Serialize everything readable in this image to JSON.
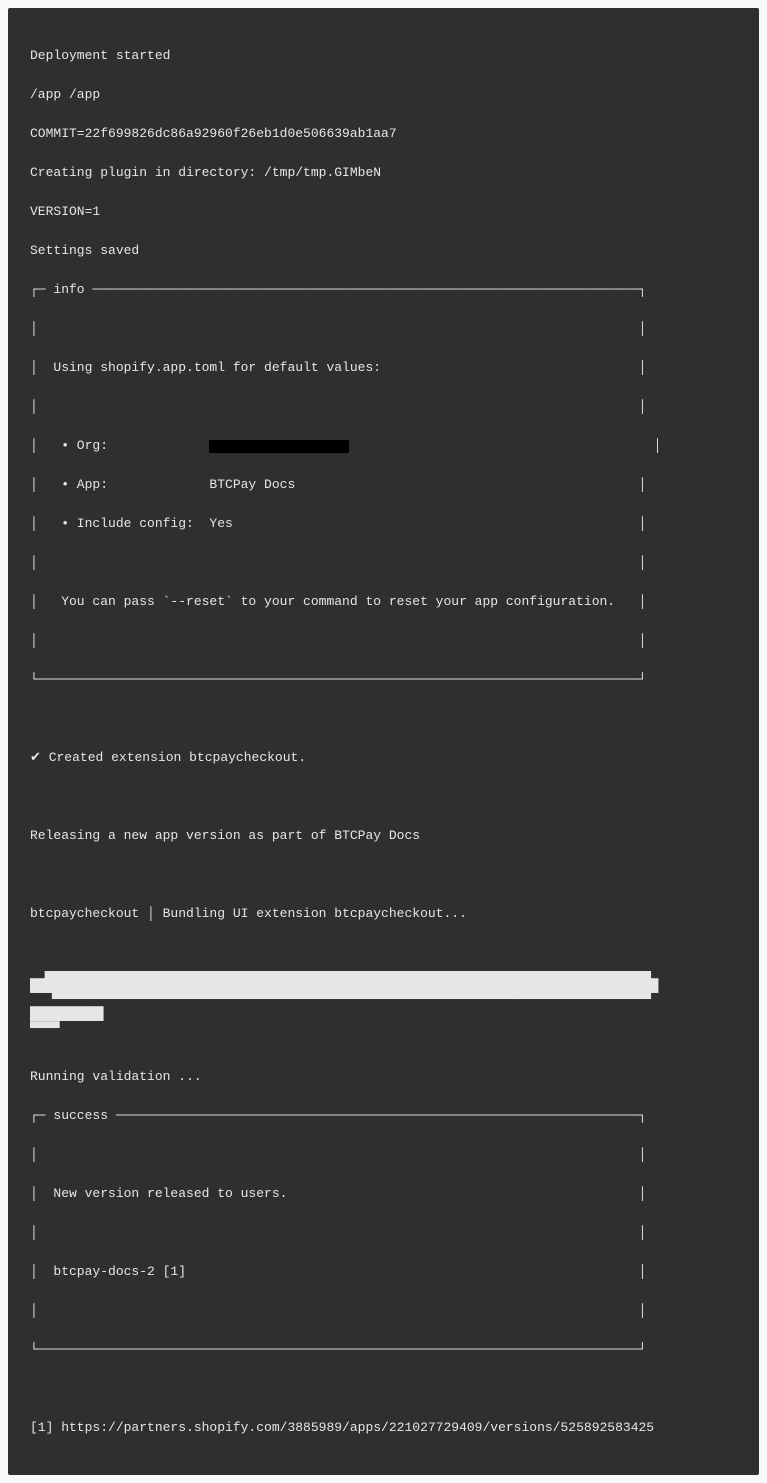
{
  "preamble": {
    "l1": "Deployment started",
    "l2": "/app /app",
    "l3": "COMMIT=22f699826dc86a92960f26eb1d0e506639ab1aa7",
    "l4": "Creating plugin in directory: /tmp/tmp.GIMbeN",
    "l5": "VERSION=1",
    "l6": "Settings saved"
  },
  "info_box": {
    "top": "┌─ info ──────────────────────────────────────────────────────────────────────┐",
    "r1": "│                                                                             │",
    "r2": "│  Using shopify.app.toml for default values:                                 │",
    "r3": "│                                                                             │",
    "r4a": "│   • Org:             ",
    "r4b": "                                       │",
    "r5": "│   • App:             BTCPay Docs                                            │",
    "r6": "│   • Include config:  Yes                                                    │",
    "r7": "│                                                                             │",
    "r8": "│   You can pass `--reset` to your command to reset your app configuration.   │",
    "r9": "│                                                                             │",
    "bot": "└─────────────────────────────────────────────────────────────────────────────┘"
  },
  "mid": {
    "l1": "✔ Created extension btcpaycheckout.",
    "l2": "Releasing a new app version as part of BTCPay Docs",
    "l3": "btcpaycheckout │ Bundling UI extension btcpaycheckout..."
  },
  "wave": {
    "r1": "  ▄▄▄▄▄▄▄▄▄▄▄▄▄▄▄▄▄▄▄▄▄▄▄▄▄▄▄▄▄▄▄▄▄▄▄▄▄▄▄▄▄▄▄▄▄▄▄▄▄▄▄▄▄▄▄▄▄▄▄▄▄▄▄▄▄▄▄▄▄▄▄▄▄▄▄▄▄▄▄▄▄▄▄",
    "r2": "██████████████████████████████████████████████████████████████████████████████████████",
    "r3": "   ▀▀▀▀▀▀▀▀▀▀▀▀▀▀▀▀▀▀▀▀▀▀▀▀▀▀▀▀▀▀▀▀▀▀▀▀▀▀▀▀▀▀▀▀▀▀▀▀▀▀▀▀▀▀▀▀▀▀▀▀▀▀▀▀▀▀▀▀▀▀▀▀▀▀▀▀▀▀▀▀▀▀",
    "r4": "██████████",
    "r5": "▀▀▀▀         "
  },
  "running": "Running validation ...",
  "success_box": {
    "top": "┌─ success ───────────────────────────────────────────────────────────────────┐",
    "r1": "│                                                                             │",
    "r2": "│  New version released to users.                                             │",
    "r3": "│                                                                             │",
    "r4": "│  btcpay-docs-2 [1]                                                          │",
    "r5": "│                                                                             │",
    "bot": "└─────────────────────────────────────────────────────────────────────────────┘"
  },
  "footer": "[1] https://partners.shopify.com/3885989/apps/221027729409/versions/525892583425"
}
